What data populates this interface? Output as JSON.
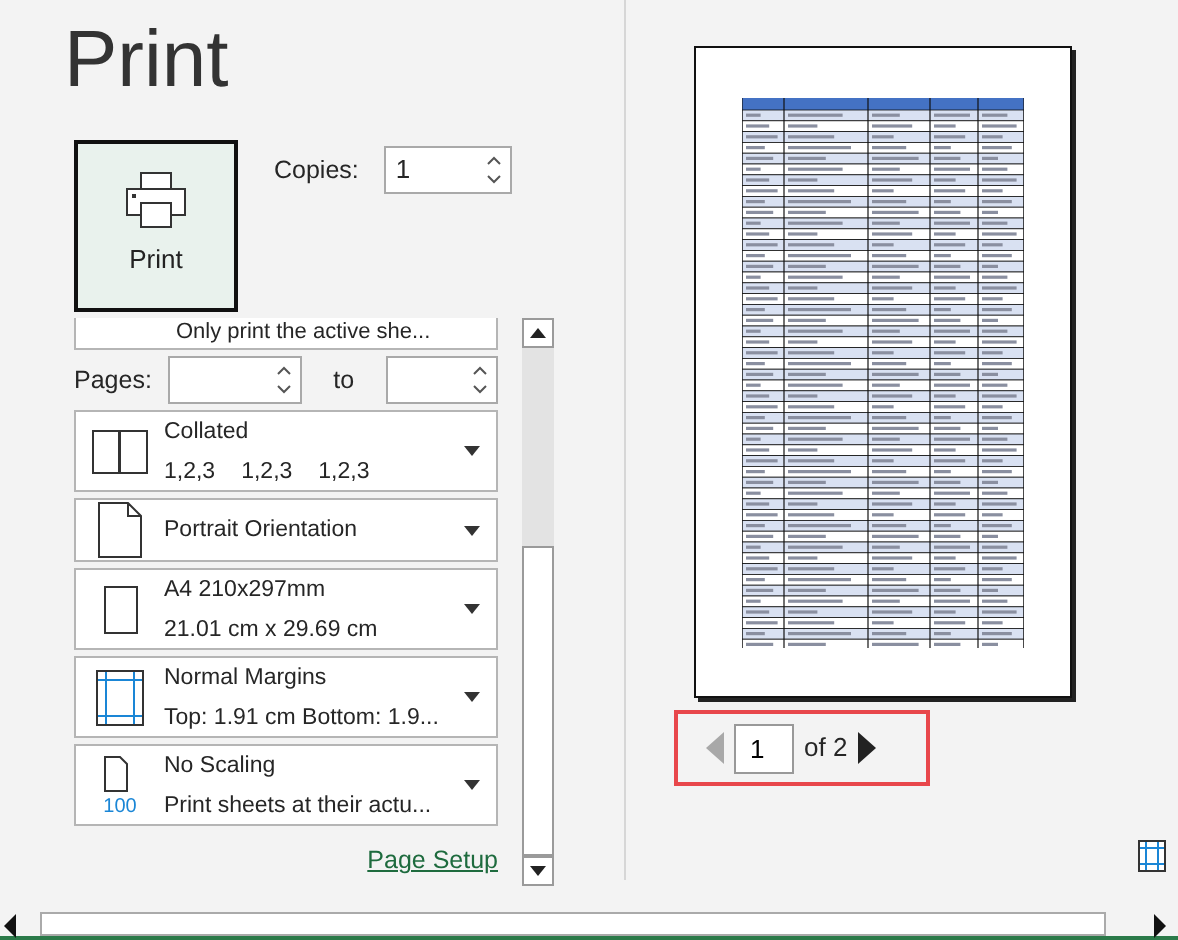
{
  "title": "Print",
  "print_button": {
    "label": "Print"
  },
  "copies": {
    "label": "Copies:",
    "value": "1"
  },
  "partial_option": "Only print the active she...",
  "pages": {
    "label": "Pages:",
    "to_label": "to"
  },
  "dropdowns": [
    {
      "kind": "collated",
      "title": "Collated",
      "subtitle_parts": [
        "1,2,3",
        "1,2,3",
        "1,2,3"
      ]
    },
    {
      "kind": "portrait",
      "title": "Portrait Orientation"
    },
    {
      "kind": "paper",
      "title": "A4 210x297mm",
      "subtitle_parts": [
        "21.01 cm x 29.69 cm"
      ]
    },
    {
      "kind": "margins",
      "title": "Normal Margins",
      "subtitle_parts": [
        "Top: 1.91 cm Bottom: 1.9..."
      ]
    },
    {
      "kind": "scaling",
      "title": "No Scaling",
      "subtitle_parts": [
        "Print sheets at their actu..."
      ],
      "icon_text": "100"
    }
  ],
  "page_setup_link": "Page Setup",
  "preview_nav": {
    "page": "1",
    "of_label": "of 2",
    "previous_disabled": true,
    "next_disabled": false
  }
}
